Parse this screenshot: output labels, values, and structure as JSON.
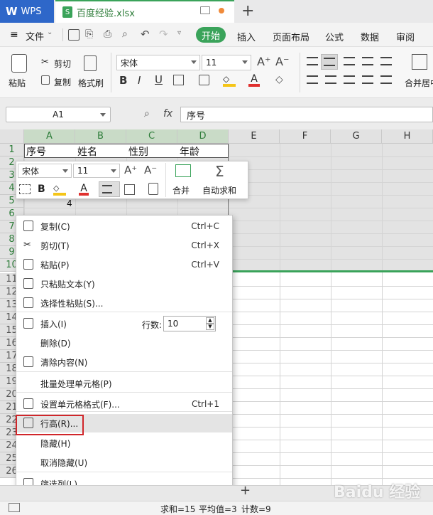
{
  "app": {
    "name": "WPS",
    "file_tab": "百度经验.xlsx"
  },
  "menu": {
    "file": "文件",
    "tabs": [
      "开始",
      "插入",
      "页面布局",
      "公式",
      "数据",
      "审阅"
    ]
  },
  "ribbon": {
    "paste": "粘贴",
    "cut": "剪切",
    "copy": "复制",
    "format_painter": "格式刷",
    "font_name": "宋体",
    "font_size": "11",
    "merge_center": "合并居中"
  },
  "formula_bar": {
    "cell_ref": "A1",
    "fx": "fx",
    "content": "序号"
  },
  "columns": [
    "A",
    "B",
    "C",
    "D",
    "E",
    "F",
    "G",
    "H"
  ],
  "rows": [
    "1",
    "2",
    "3",
    "4",
    "5",
    "6",
    "7",
    "8",
    "9",
    "10",
    "11",
    "12",
    "13",
    "14",
    "15",
    "16",
    "17",
    "18",
    "19",
    "20",
    "21",
    "22",
    "23",
    "24",
    "25",
    "26"
  ],
  "cells": {
    "A1": "序号",
    "B1": "姓名",
    "C1": "性别",
    "D1": "年龄",
    "A5": "4"
  },
  "mini_toolbar": {
    "font_name": "宋体",
    "font_size": "11",
    "merge": "合并",
    "autosum": "自动求和"
  },
  "context_menu": {
    "items": [
      {
        "label": "复制(C)",
        "shortcut": "Ctrl+C"
      },
      {
        "label": "剪切(T)",
        "shortcut": "Ctrl+X"
      },
      {
        "label": "粘贴(P)",
        "shortcut": "Ctrl+V"
      },
      {
        "label": "只粘贴文本(Y)",
        "shortcut": ""
      },
      {
        "label": "选择性粘贴(S)...",
        "shortcut": ""
      },
      {
        "label": "插入(I)",
        "shortcut": ""
      },
      {
        "label": "删除(D)",
        "shortcut": ""
      },
      {
        "label": "清除内容(N)",
        "shortcut": ""
      },
      {
        "label": "批量处理单元格(P)",
        "shortcut": ""
      },
      {
        "label": "设置单元格格式(F)...",
        "shortcut": "Ctrl+1"
      },
      {
        "label": "行高(R)...",
        "shortcut": ""
      },
      {
        "label": "隐藏(H)",
        "shortcut": ""
      },
      {
        "label": "取消隐藏(U)",
        "shortcut": ""
      },
      {
        "label": "筛选列(L)...",
        "shortcut": ""
      }
    ],
    "rows_label": "行数:",
    "rows_value": "10"
  },
  "status": {
    "sum": "求和=15",
    "avg": "平均值=3",
    "count": "计数=9"
  },
  "watermark": "Baidu 经验"
}
